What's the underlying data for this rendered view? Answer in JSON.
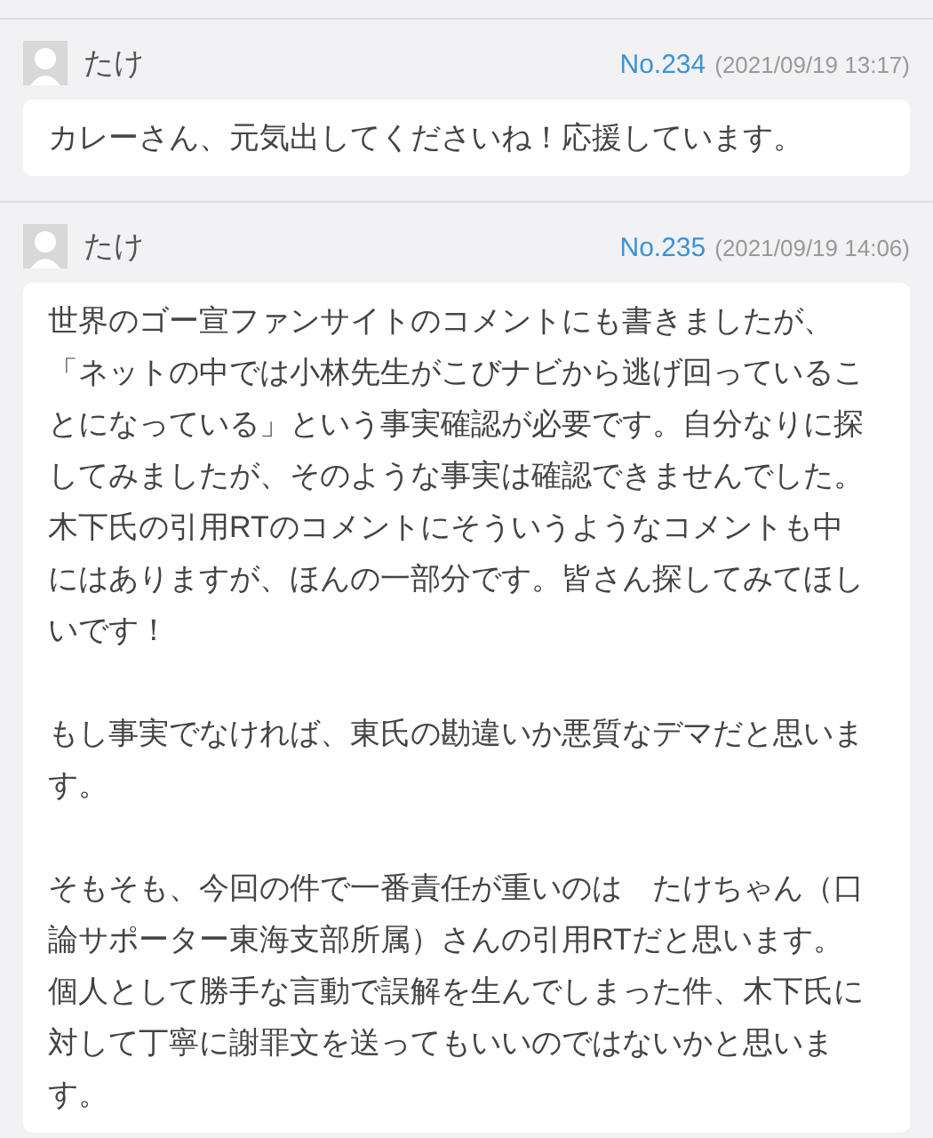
{
  "comments": [
    {
      "author": "たけ",
      "number": "No.234",
      "date": "(2021/09/19 13:17)",
      "paragraphs": [
        "カレーさん、元気出してくださいね！応援しています。"
      ]
    },
    {
      "author": "たけ",
      "number": "No.235",
      "date": "(2021/09/19 14:06)",
      "paragraphs": [
        "世界のゴー宣ファンサイトのコメントにも書きましたが、「ネットの中では小林先生がこびナビから逃げ回っていることになっている」という事実確認が必要です。自分なりに探してみましたが、そのような事実は確認できませんでした。木下氏の引用RTのコメントにそういうようなコメントも中にはありますが、ほんの一部分です。皆さん探してみてほしいです！",
        "もし事実でなければ、東氏の勘違いか悪質なデマだと思います。",
        "そもそも、今回の件で一番責任が重いのは　たけちゃん（口論サポーター東海支部所属）さんの引用RTだと思います。個人として勝手な言動で誤解を生んでしまった件、木下氏に対して丁寧に謝罪文を送ってもいいのではないかと思います。"
      ]
    }
  ]
}
